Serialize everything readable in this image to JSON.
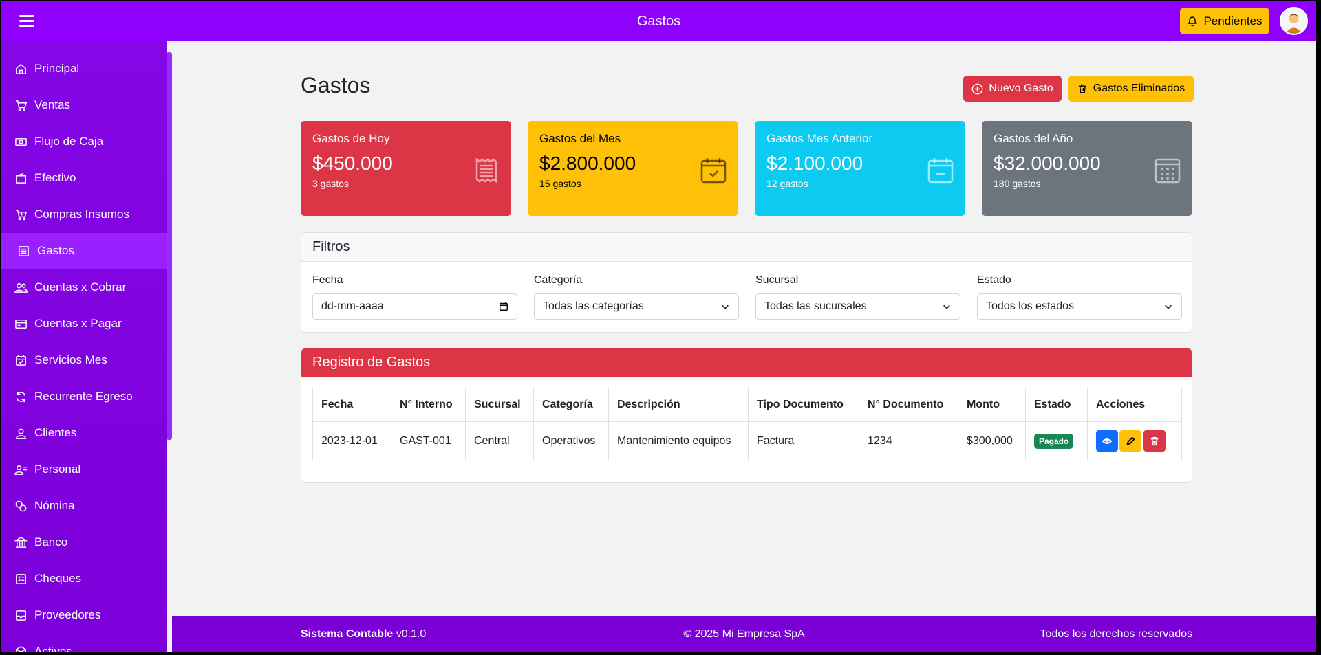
{
  "topbar": {
    "title": "Gastos",
    "pending_label": "Pendientes"
  },
  "sidebar": {
    "items": [
      {
        "label": "Principal",
        "icon": "home-icon"
      },
      {
        "label": "Ventas",
        "icon": "cart-icon"
      },
      {
        "label": "Flujo de Caja",
        "icon": "cash-icon"
      },
      {
        "label": "Efectivo",
        "icon": "wallet-icon"
      },
      {
        "label": "Compras Insumos",
        "icon": "cart-plus-icon"
      },
      {
        "label": "Gastos",
        "icon": "receipt-icon",
        "active": true
      },
      {
        "label": "Cuentas x Cobrar",
        "icon": "people-icon"
      },
      {
        "label": "Cuentas x Pagar",
        "icon": "credit-card-icon"
      },
      {
        "label": "Servicios Mes",
        "icon": "calendar-check-icon"
      },
      {
        "label": "Recurrente Egreso",
        "icon": "refresh-icon"
      },
      {
        "label": "Clientes",
        "icon": "person-icon"
      },
      {
        "label": "Personal",
        "icon": "person-badge-icon"
      },
      {
        "label": "Nómina",
        "icon": "coins-icon"
      },
      {
        "label": "Banco",
        "icon": "bank-icon"
      },
      {
        "label": "Cheques",
        "icon": "checklist-icon"
      },
      {
        "label": "Proveedores",
        "icon": "box-icon"
      },
      {
        "label": "Activos",
        "icon": "cube-icon"
      }
    ]
  },
  "page": {
    "title": "Gastos",
    "new_button": "Nuevo Gasto",
    "deleted_button": "Gastos Eliminados"
  },
  "cards": [
    {
      "label": "Gastos de Hoy",
      "value": "$450.000",
      "sub": "3 gastos",
      "color": "#dc3545",
      "icon": "receipt-icon"
    },
    {
      "label": "Gastos del Mes",
      "value": "$2.800.000",
      "sub": "15 gastos",
      "color": "#ffc107",
      "icon": "calendar-check-icon"
    },
    {
      "label": "Gastos Mes Anterior",
      "value": "$2.100.000",
      "sub": "12 gastos",
      "color": "#0dcaf0",
      "icon": "calendar-minus-icon"
    },
    {
      "label": "Gastos del Año",
      "value": "$32.000.000",
      "sub": "180 gastos",
      "color": "#6c757d",
      "icon": "calendar-grid-icon"
    }
  ],
  "filters": {
    "title": "Filtros",
    "fecha_label": "Fecha",
    "fecha_placeholder": "dd-mm-aaaa",
    "categoria_label": "Categoría",
    "categoria_value": "Todas las categorías",
    "sucursal_label": "Sucursal",
    "sucursal_value": "Todas las sucursales",
    "estado_label": "Estado",
    "estado_value": "Todos los estados"
  },
  "registro": {
    "title": "Registro de Gastos",
    "columns": [
      "Fecha",
      "N° Interno",
      "Sucursal",
      "Categoría",
      "Descripción",
      "Tipo Documento",
      "N° Documento",
      "Monto",
      "Estado",
      "Acciones"
    ],
    "rows": [
      {
        "fecha": "2023-12-01",
        "interno": "GAST-001",
        "sucursal": "Central",
        "categoria": "Operativos",
        "descripcion": "Mantenimiento equipos",
        "tipo": "Factura",
        "documento": "1234",
        "monto": "$300,000",
        "estado": "Pagado"
      }
    ]
  },
  "footer": {
    "app_name": "Sistema Contable",
    "version": "v0.1.0",
    "copyright": "© 2025 Mi Empresa SpA",
    "rights": "Todos los derechos reservados"
  }
}
